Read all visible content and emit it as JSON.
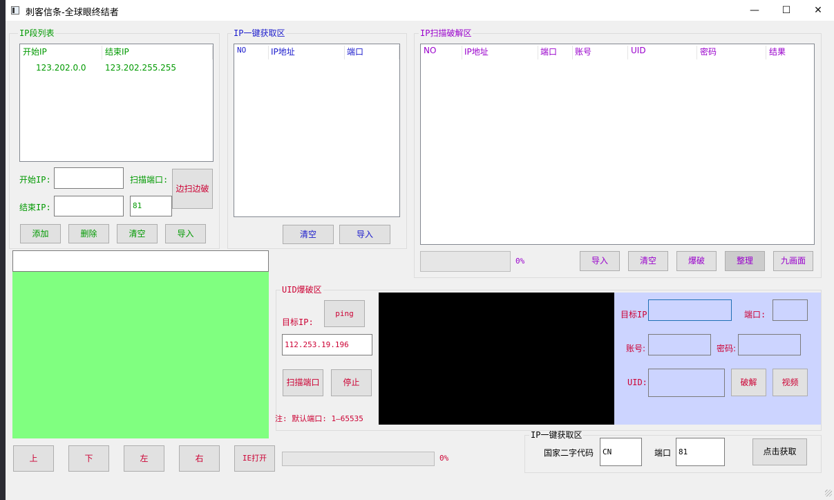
{
  "window": {
    "title": "刺客信条-全球眼终结者",
    "controls": {
      "minimize": "—",
      "maximize": "☐",
      "close": "✕"
    }
  },
  "ip_list": {
    "title": "IP段列表",
    "columns": [
      "开始IP",
      "结束IP"
    ],
    "rows": [
      [
        "123.202.0.0",
        "123.202.255.255"
      ]
    ],
    "start_ip_label": "开始IP:",
    "end_ip_label": "结束IP:",
    "scan_port_label": "扫描端口:",
    "start_ip_value": "",
    "end_ip_value": "",
    "scan_port_value": "81",
    "scan_crack_button": "边扫边破",
    "buttons": {
      "add": "添加",
      "delete": "删除",
      "clear": "清空",
      "import": "导入"
    }
  },
  "ip_fetch": {
    "title": "IP一键获取区",
    "columns": [
      "NO",
      "IP地址",
      "端口"
    ],
    "buttons": {
      "clear": "清空",
      "import": "导入"
    }
  },
  "scan_crack": {
    "title": "IP扫描破解区",
    "columns": [
      "NO",
      "IP地址",
      "端口",
      "账号",
      "UID",
      "密码",
      "结果"
    ],
    "progress_text": "0%",
    "progress": 0,
    "buttons": {
      "import": "导入",
      "clear": "清空",
      "crack": "爆破",
      "organize": "整理",
      "nine_view": "九画面"
    }
  },
  "preview": {
    "top_input_value": "",
    "buttons": {
      "up": "上",
      "down": "下",
      "left": "左",
      "right": "右",
      "ie_open": "IE打开"
    },
    "progress_text": "0%",
    "progress": 0
  },
  "uid_crack": {
    "title": "UID爆破区",
    "target_ip_label": "目标IP:",
    "ping_button": "ping",
    "target_ip_value": "112.253.19.196",
    "scan_port_button": "扫描端口",
    "stop_button": "停止",
    "note": "注: 默认端口: 1—65535"
  },
  "target_panel": {
    "target_ip_label": "目标IP:",
    "port_label": "端口:",
    "account_label": "账号:",
    "password_label": "密码:",
    "uid_label": "UID:",
    "crack_button": "破解",
    "video_button": "视频"
  },
  "country_fetch": {
    "title": "IP一键获取区",
    "country_label": "国家二字代码",
    "country_value": "CN",
    "port_label": "端口",
    "port_value": "81",
    "fetch_button": "点击获取"
  },
  "colors": {
    "green": "#009900",
    "blue": "#1a1acc",
    "purple": "#9900cc",
    "red": "#cc0033",
    "preview_green": "#80ff80",
    "panel_lavender": "#ccd4ff"
  }
}
